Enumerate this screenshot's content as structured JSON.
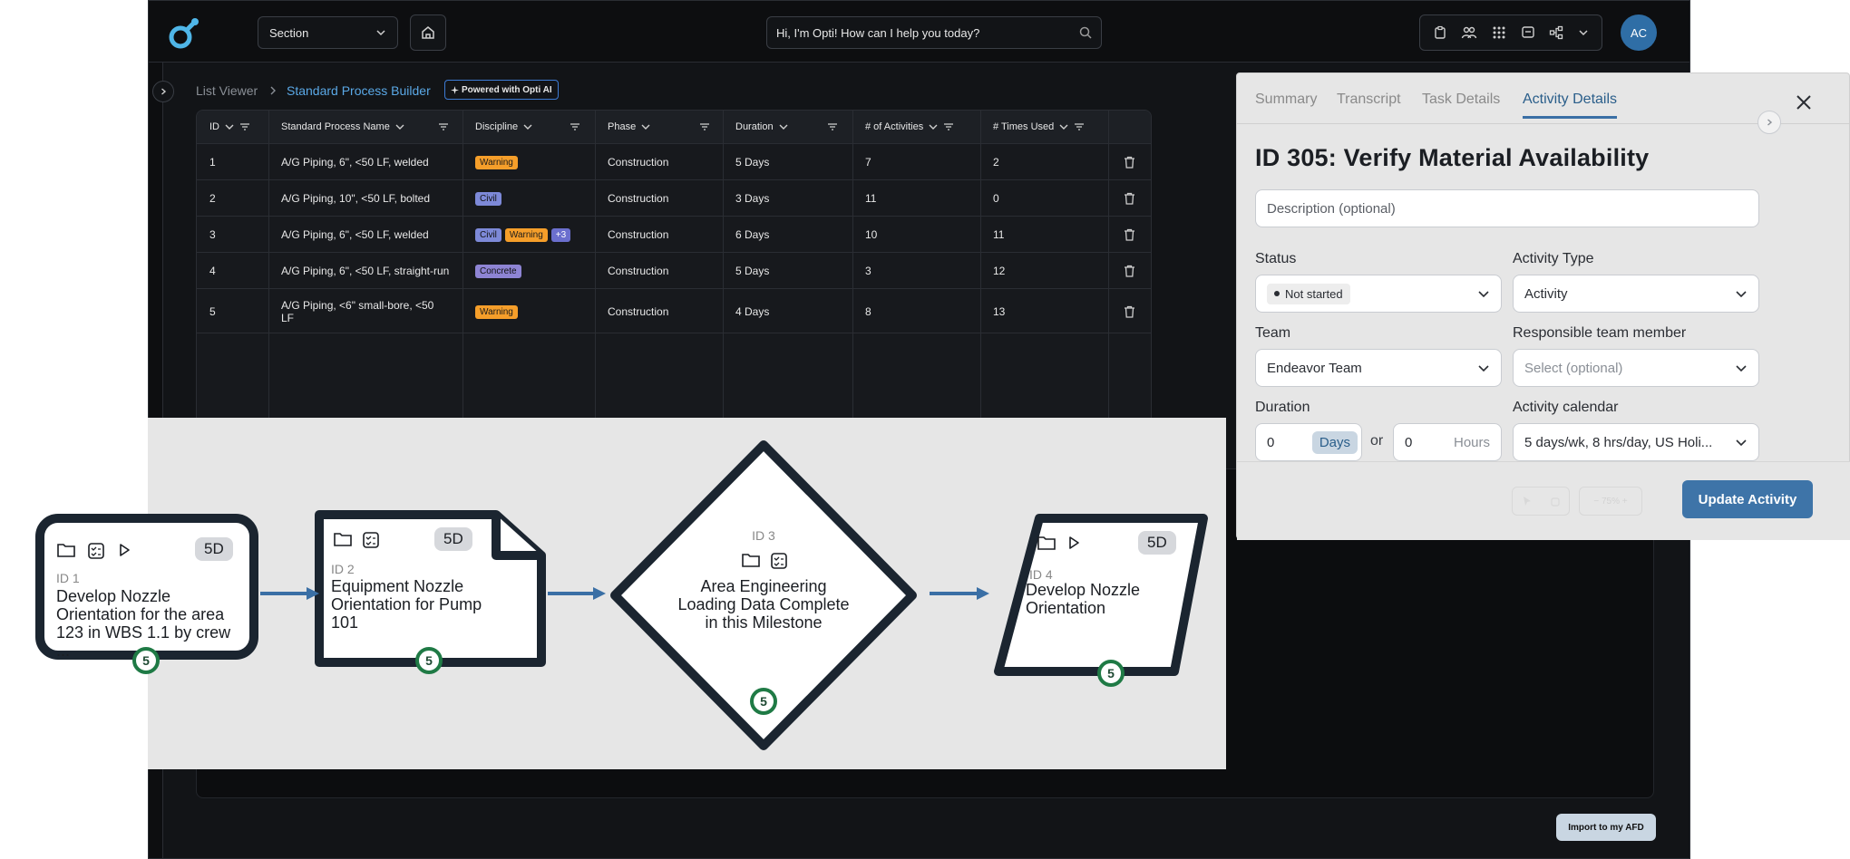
{
  "header": {
    "section_label": "Section",
    "search_placeholder": "Hi, I'm Opti! How can I help you today?",
    "avatar_initials": "AC"
  },
  "breadcrumb": {
    "root": "List Viewer",
    "separator": ">",
    "current": "Standard Process Builder",
    "badge": "Powered with Opti AI"
  },
  "table": {
    "headers": [
      "ID",
      "Standard Process Name",
      "Discipline",
      "Phase",
      "Duration",
      "# of Activities",
      "# Times Used"
    ],
    "rows": [
      {
        "id": "1",
        "name": "A/G Piping, 6\", <50 LF, welded",
        "chips": [
          "Warning"
        ],
        "phase": "Construction",
        "duration": "5 Days",
        "activities": "7",
        "used": "2"
      },
      {
        "id": "2",
        "name": "A/G Piping, 10\", <50 LF, bolted",
        "chips": [
          "Civil"
        ],
        "phase": "Construction",
        "duration": "3 Days",
        "activities": "11",
        "used": "0"
      },
      {
        "id": "3",
        "name": "A/G Piping, 6\", <50 LF, welded",
        "chips": [
          "Civil",
          "Warning",
          "+3"
        ],
        "phase": "Construction",
        "duration": "6 Days",
        "activities": "10",
        "used": "11"
      },
      {
        "id": "4",
        "name": "A/G Piping, 6\", <50 LF, straight-run",
        "chips": [
          "Concrete"
        ],
        "phase": "Construction",
        "duration": "5 Days",
        "activities": "3",
        "used": "12"
      },
      {
        "id": "5",
        "name": "A/G Piping, <6\" small-bore, <50 LF",
        "chips": [
          "Warning"
        ],
        "phase": "Construction",
        "duration": "4 Days",
        "activities": "8",
        "used": "13"
      }
    ]
  },
  "import_button": "Import to my AFD",
  "details": {
    "tabs": [
      "Summary",
      "Transcript",
      "Task Details",
      "Activity Details"
    ],
    "active_tab": "Activity Details",
    "title": "ID 305: Verify Material Availability",
    "description_placeholder": "Description (optional)",
    "status_label": "Status",
    "status_value": "Not started",
    "activity_type_label": "Activity Type",
    "activity_type_value": "Activity",
    "team_label": "Team",
    "team_value": "Endeavor Team",
    "responsible_label": "Responsible team member",
    "responsible_placeholder": "Select (optional)",
    "duration_label": "Duration",
    "days_value": "0",
    "days_unit": "Days",
    "or_text": "or",
    "hours_value": "0",
    "hours_unit": "Hours",
    "calendar_label": "Activity calendar",
    "calendar_value": "5 days/wk, 8 hrs/day, US Holi...",
    "zoom_text": "−  75%  +",
    "update_button": "Update Activity"
  },
  "diagram": {
    "nodes": [
      {
        "id_label": "ID 1",
        "text": "Develop Nozzle Orientation for the area 123 in WBS 1.1 by crew ...",
        "duration": "5D",
        "badge": "5"
      },
      {
        "id_label": "ID 2",
        "text": "Equipment Nozzle Orientation for Pump 101",
        "duration": "5D",
        "badge": "5"
      },
      {
        "id_label": "ID 3",
        "text": "Area Engineering Loading Data Complete in this Milestone",
        "badge": "5"
      },
      {
        "id_label": "ID 4",
        "text": "Develop Nozzle Orientation",
        "duration": "5D",
        "badge": "5"
      }
    ],
    "colors": {
      "stroke": "#1b2530",
      "arrow": "#3a6fa5",
      "badge": "#1f7a45"
    }
  }
}
